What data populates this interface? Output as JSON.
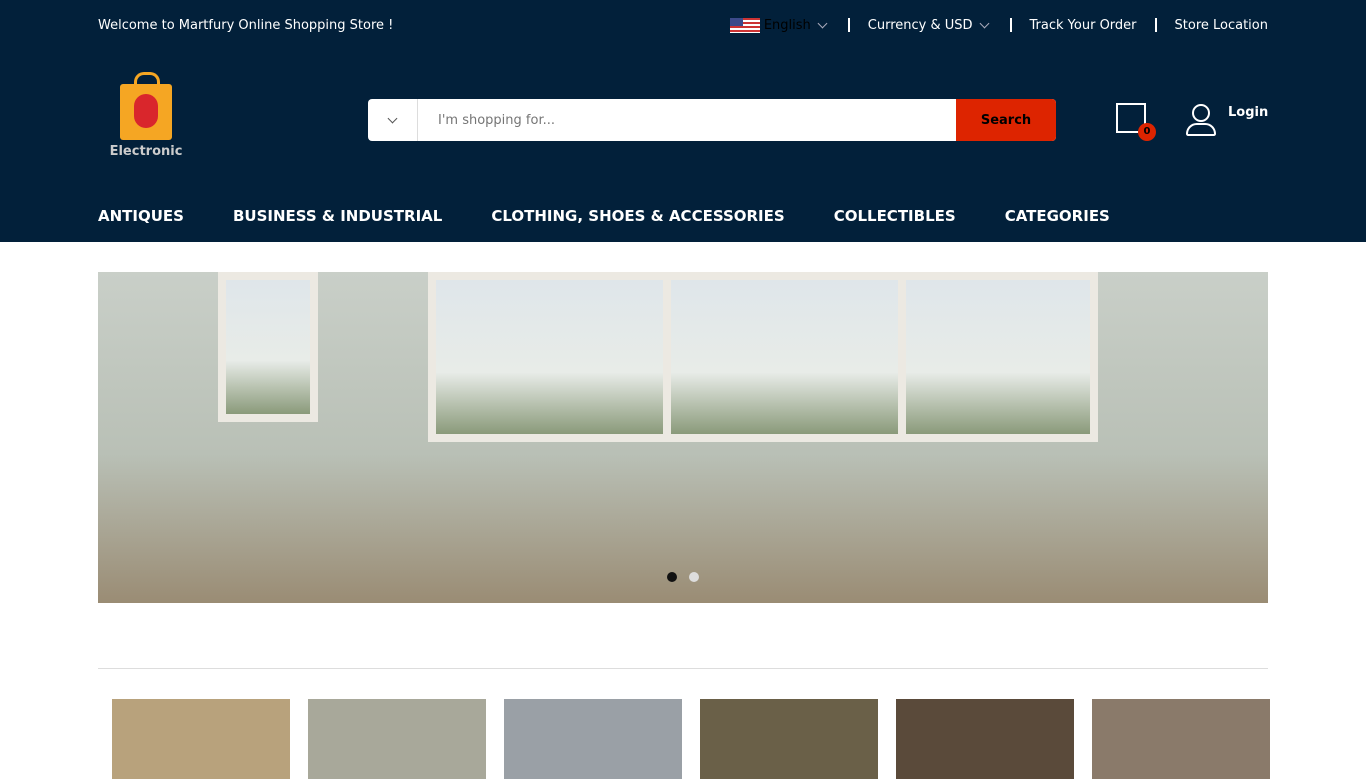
{
  "topbar": {
    "welcome": "Welcome to Martfury Online Shopping Store !",
    "language": "English",
    "currency": "Currency & USD",
    "track": "Track Your Order",
    "store": "Store Location"
  },
  "logo": {
    "text": "Electronic"
  },
  "search": {
    "placeholder": "I'm shopping for...",
    "button": "Search"
  },
  "cart": {
    "count": "0"
  },
  "account": {
    "login": "Login"
  },
  "nav": [
    "ANTIQUES",
    "BUSINESS & INDUSTRIAL",
    "CLOTHING, SHOES & ACCESSORIES",
    "COLLECTIBLES",
    "CATEGORIES"
  ],
  "slider": {
    "slides": 2,
    "active": 1
  },
  "thumb_colors": [
    "#b8a27c",
    "#a8a89a",
    "#9aa0a6",
    "#6a6048",
    "#5a4a3a",
    "#8a7a6a"
  ]
}
